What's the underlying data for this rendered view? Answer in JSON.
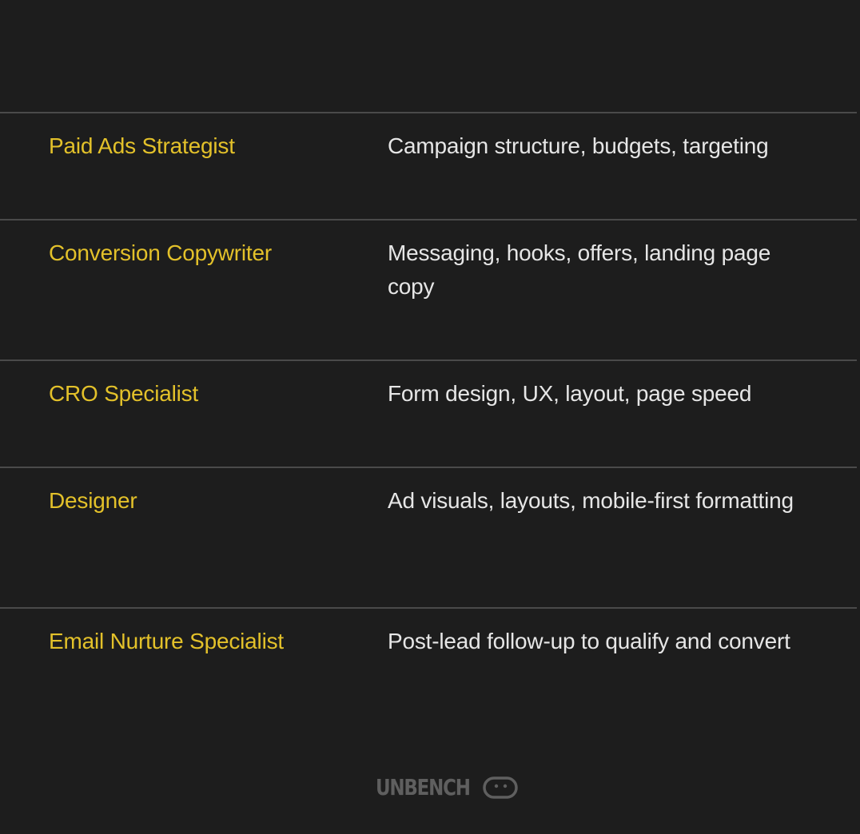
{
  "rows": [
    {
      "role": "Paid Ads Strategist",
      "description": "Campaign structure, budgets, targeting"
    },
    {
      "role": "Conversion Copywriter",
      "description": "Messaging, hooks, offers, landing page copy"
    },
    {
      "role": "CRO Specialist",
      "description": "Form design, UX, layout, page speed"
    },
    {
      "role": "Designer",
      "description": "Ad visuals, layouts, mobile-first formatting"
    },
    {
      "role": "Email Nurture Specialist",
      "description": "Post-lead follow-up to qualify and convert"
    }
  ],
  "brand": {
    "name": "UNBENCH",
    "icon": "smiley-face-icon"
  },
  "colors": {
    "background": "#1d1d1d",
    "role_text": "#e3c12a",
    "description_text": "#e6e6e6",
    "divider": "#4a4a4a",
    "logo": "#5f5f5f"
  }
}
